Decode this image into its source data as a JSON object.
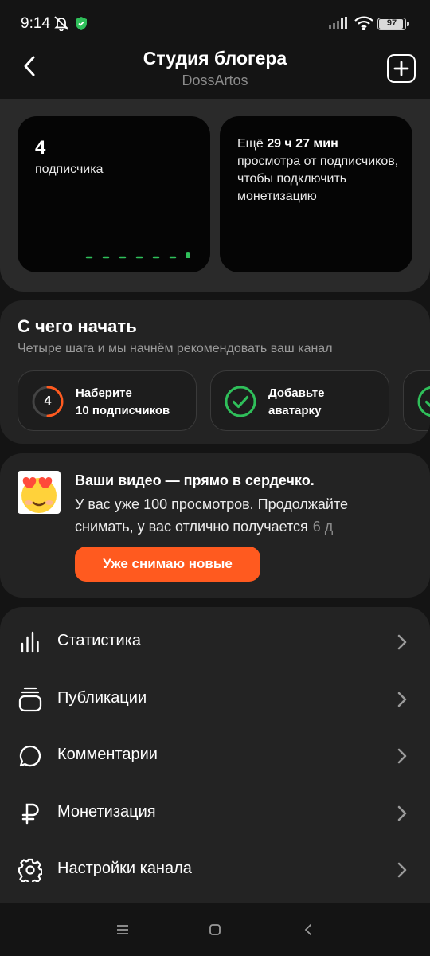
{
  "status_bar": {
    "time": "9:14",
    "battery": "97",
    "icons": [
      "bell-off-icon",
      "shield-icon",
      "signal-icon",
      "wifi-icon",
      "battery-icon"
    ]
  },
  "header": {
    "title": "Студия блогера",
    "subtitle": "DossArtos",
    "back_icon": "chevron-left-icon",
    "add_icon": "plus-square-icon"
  },
  "stats": {
    "subscribers_count": "4",
    "subscribers_label": "подписчика",
    "monetization_prefix": "Ещё ",
    "monetization_highlight": "29 ч 27 мин",
    "monetization_suffix": "просмотра от подписчиков, чтобы подключить монетизацию"
  },
  "start": {
    "title": "С чего начать",
    "subtitle": "Четыре шага и мы начнём рекомендовать ваш канал",
    "steps": [
      {
        "badge": "4",
        "line1": "Наберите",
        "line2": "10 подписчиков",
        "status": "in-progress"
      },
      {
        "badge": "",
        "line1": "Добавьте",
        "line2": "аватарку",
        "status": "done"
      },
      {
        "badge": "",
        "line1": "",
        "line2": "",
        "status": "done"
      }
    ]
  },
  "notification": {
    "title": "Ваши видео — прямо в сердечко.",
    "body": "У вас уже 100 просмотров. Продолжайте снимать, у вас отлично получается",
    "time": "6 д",
    "button": "Уже снимаю новые",
    "emoji_icon": "heart-eyes-emoji-icon"
  },
  "menu": {
    "items": [
      {
        "label": "Статистика",
        "icon": "bar-chart-icon"
      },
      {
        "label": "Публикации",
        "icon": "stack-icon"
      },
      {
        "label": "Комментарии",
        "icon": "comment-icon"
      },
      {
        "label": "Монетизация",
        "icon": "ruble-icon"
      },
      {
        "label": "Настройки канала",
        "icon": "gear-icon"
      }
    ]
  },
  "colors": {
    "accent": "#ff5a1f",
    "success": "#2fbf5a",
    "background": "#141414",
    "card": "#232323"
  }
}
